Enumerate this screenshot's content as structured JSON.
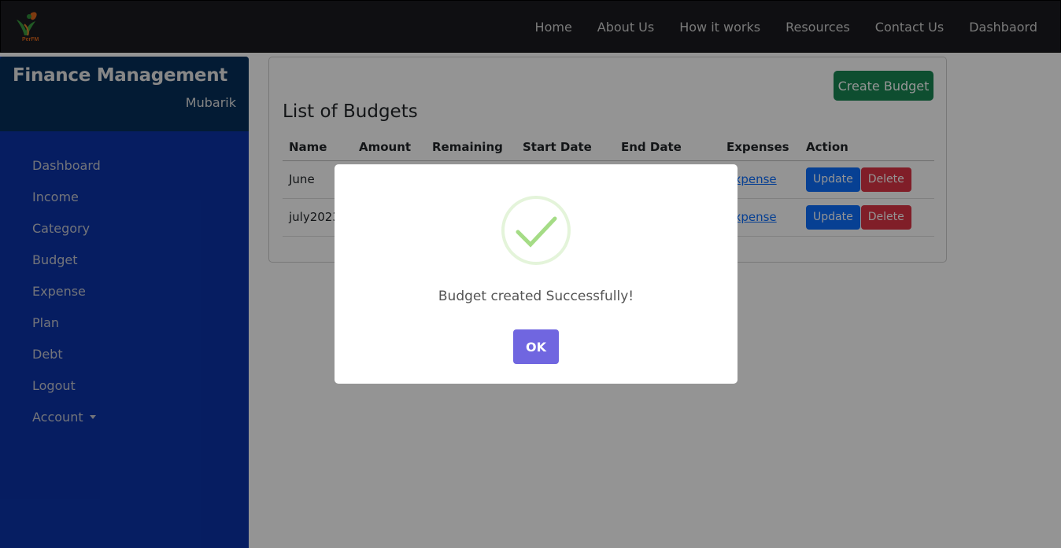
{
  "brand": {
    "logo_text": "PerFM",
    "logo_icon": "person-leaf-logo-icon"
  },
  "nav": {
    "links": [
      "Home",
      "About Us",
      "How it works",
      "Resources",
      "Contact Us",
      "Dashbaord"
    ]
  },
  "sidebar": {
    "title": "Finance Management",
    "user": "Mubarik",
    "items": [
      {
        "label": "Dashboard"
      },
      {
        "label": "Income"
      },
      {
        "label": "Category"
      },
      {
        "label": "Budget"
      },
      {
        "label": "Expense"
      },
      {
        "label": "Plan"
      },
      {
        "label": "Debt"
      },
      {
        "label": "Logout"
      },
      {
        "label": "Account"
      }
    ]
  },
  "main": {
    "create_label": "Create Budget",
    "title": "List of Budgets",
    "columns": [
      "Name",
      "Amount",
      "Remaining",
      "Start Date",
      "End Date",
      "Expenses",
      "Action"
    ],
    "rows": [
      {
        "name": "June",
        "expense_link": "Expense",
        "update": "Update",
        "delete": "Delete"
      },
      {
        "name": "july2023",
        "expense_link": "Expense",
        "update": "Update",
        "delete": "Delete"
      }
    ]
  },
  "modal": {
    "message": "Budget created Successfully!",
    "ok_label": "OK",
    "icon": "check-icon"
  },
  "colors": {
    "navbar": "#1a1b1f",
    "sidebar": "#0b33a8",
    "sidebar_header": "#06305a",
    "create_button": "#198754",
    "update_button": "#0d6efd",
    "delete_button": "#dc3545",
    "ok_button": "#7066e0",
    "success_check": "#a5dc86"
  }
}
